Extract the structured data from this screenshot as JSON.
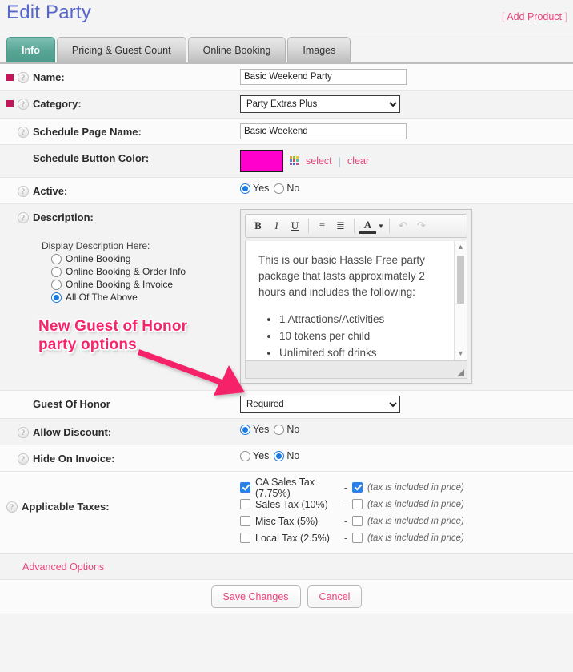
{
  "header": {
    "title": "Edit Party",
    "add_product_label": "Add Product",
    "bracket_open": "[",
    "bracket_close": "]"
  },
  "tabs": [
    {
      "label": "Info",
      "active": true
    },
    {
      "label": "Pricing & Guest Count",
      "active": false
    },
    {
      "label": "Online Booking",
      "active": false
    },
    {
      "label": "Images",
      "active": false
    }
  ],
  "form": {
    "name": {
      "label": "Name:",
      "value": "Basic Weekend Party",
      "required": true
    },
    "category": {
      "label": "Category:",
      "value": "Party Extras Plus",
      "required": true
    },
    "schedule_page_name": {
      "label": "Schedule Page Name:",
      "value": "Basic Weekend",
      "required": false
    },
    "schedule_button_color": {
      "label": "Schedule Button Color:",
      "color": "#FF00CC",
      "select_label": "select",
      "separator": "|",
      "clear_label": "clear"
    },
    "active": {
      "label": "Active:",
      "yes_label": "Yes",
      "no_label": "No",
      "selected": "Yes"
    },
    "description": {
      "label": "Description:",
      "display_title": "Display Description Here:",
      "options": [
        "Online Booking",
        "Online Booking & Order Info",
        "Online Booking & Invoice",
        "All Of The Above"
      ],
      "selected": "All Of The Above",
      "editor": {
        "toolbar": [
          {
            "name": "bold",
            "glyph": "B"
          },
          {
            "name": "italic",
            "glyph": "I"
          },
          {
            "name": "underline",
            "glyph": "U"
          },
          {
            "name": "numbered-list",
            "glyph": "≡"
          },
          {
            "name": "bulleted-list",
            "glyph": "≣"
          },
          {
            "name": "font-color",
            "glyph": "A"
          },
          {
            "name": "undo",
            "glyph": "↶"
          },
          {
            "name": "redo",
            "glyph": "↷"
          }
        ],
        "paragraph": "This is our basic Hassle Free party package that lasts approximately 2 hours and includes the following:",
        "bullets": [
          "1 Attractions/Activities",
          "10 tokens per child",
          "Unlimited soft drinks"
        ]
      }
    },
    "guest_of_honor": {
      "label": "Guest Of Honor",
      "value": "Required"
    },
    "allow_discount": {
      "label": "Allow Discount:",
      "yes_label": "Yes",
      "no_label": "No",
      "selected": "Yes"
    },
    "hide_on_invoice": {
      "label": "Hide On Invoice:",
      "yes_label": "Yes",
      "no_label": "No",
      "selected": "No"
    },
    "applicable_taxes": {
      "label": "Applicable Taxes:",
      "dash": "-",
      "included_label": "(tax is included in price)",
      "items": [
        {
          "name": "CA Sales Tax (7.75%)",
          "checked": true,
          "included": true
        },
        {
          "name": "Sales Tax (10%)",
          "checked": false,
          "included": false
        },
        {
          "name": "Misc Tax (5%)",
          "checked": false,
          "included": false
        },
        {
          "name": "Local Tax (2.5%)",
          "checked": false,
          "included": false
        }
      ]
    },
    "advanced_options_label": "Advanced Options",
    "save_label": "Save Changes",
    "cancel_label": "Cancel"
  },
  "annotation": {
    "line1": "New Guest of Honor",
    "line2": "party options",
    "color": "#F5246B"
  },
  "colors": {
    "title": "#5766CC",
    "link_pink": "#E8447C",
    "required_marker": "#C2185B",
    "active_tab": "#4E9B8C",
    "checkbox_blue": "#2A7FE8",
    "radio_blue": "#1B7AE0"
  }
}
